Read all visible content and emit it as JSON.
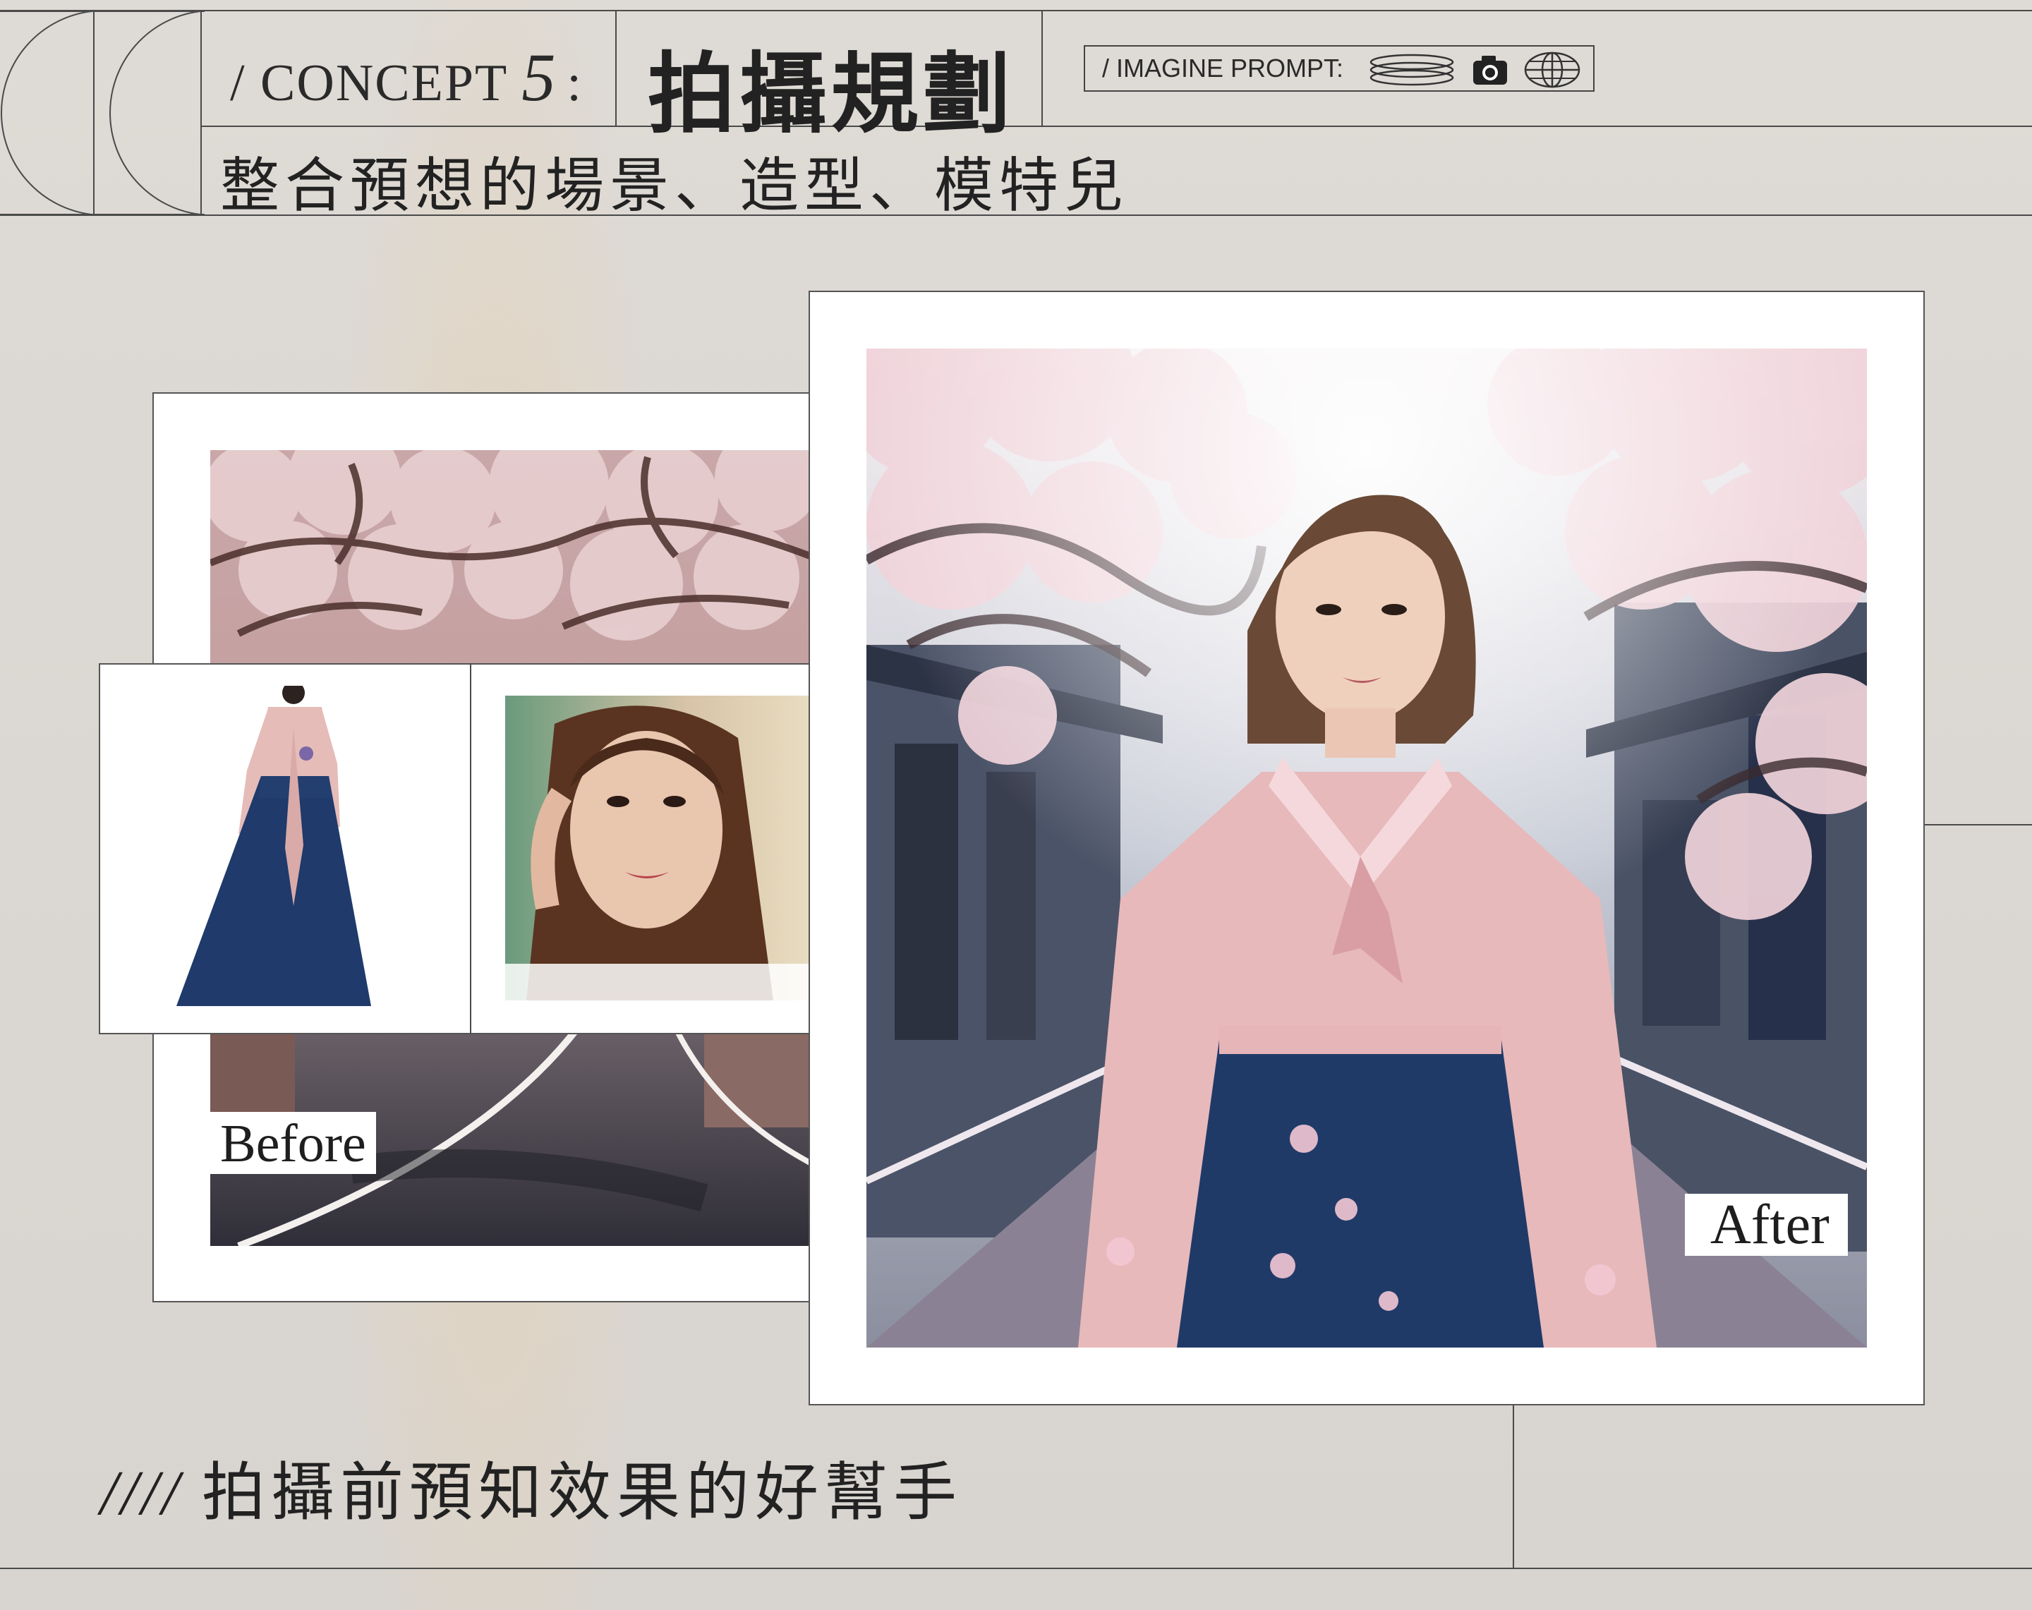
{
  "header": {
    "concept_prefix": "/ CONCEPT",
    "concept_number": "5",
    "concept_colon": ":",
    "title": "拍攝規劃",
    "subtitle": "整合預想的場景、造型、模特兒",
    "prompt_label": "/ IMAGINE PROMPT:"
  },
  "icons": [
    "stacked-lines-icon",
    "camera-icon",
    "globe-icon"
  ],
  "before": {
    "label": "Before",
    "photos": [
      "cherry-blossom-street-photo",
      "hanbok-dress-photo",
      "model-portrait-photo"
    ]
  },
  "after": {
    "label": "After",
    "photo": "hanbok-model-result-photo"
  },
  "footer": {
    "slashes": "////",
    "tagline": "拍攝前預知效果的好幫手"
  },
  "colors": {
    "background": "#dcd8d3",
    "line": "#4a4a4a",
    "frame": "#ffffff",
    "text": "#222222"
  }
}
